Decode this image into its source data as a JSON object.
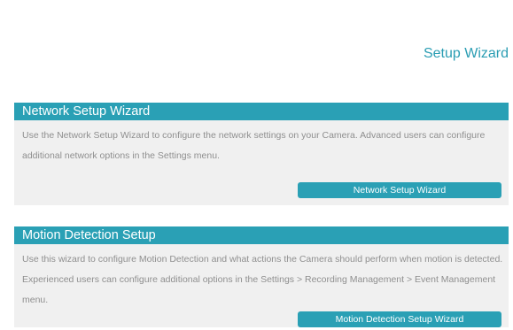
{
  "page": {
    "title": "Setup Wizard"
  },
  "network_section": {
    "title": "Network Setup Wizard",
    "description": "Use the Network Setup Wizard to configure the network settings on your Camera. Advanced users can configure additional network options in the Settings menu.",
    "button_label": "Network Setup Wizard"
  },
  "motion_section": {
    "title": "Motion Detection Setup",
    "description": "Use this wizard to configure Motion Detection and what actions the Camera should perform when motion is detected. Experienced users can configure additional options in the Settings > Recording Management > Event Management menu.",
    "button_label": "Motion Detection Setup Wizard"
  },
  "colors": {
    "accent": "#2aa0b5",
    "heading_text": "#2a9db3",
    "body_text": "#8f8f8f",
    "panel_background": "#f0f0f0"
  }
}
